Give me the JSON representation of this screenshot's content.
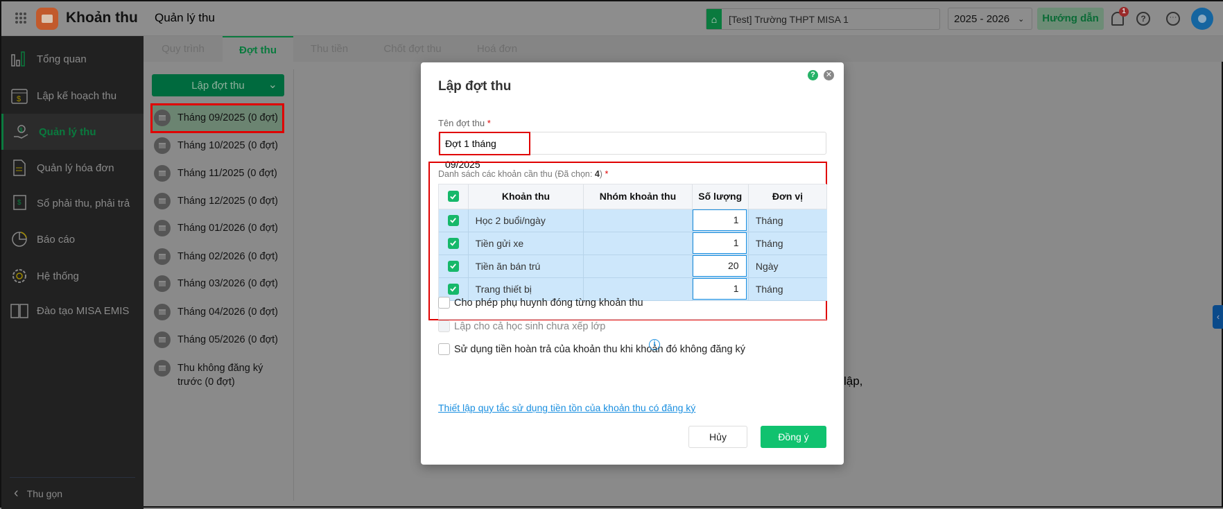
{
  "topbar": {
    "app_name": "Khoản thu",
    "page_title": "Quản lý thu",
    "school": "[Test] Trường THPT MISA 1",
    "school_year": "2025 - 2026",
    "guide_label": "Hướng dẫn",
    "notification_count": "1"
  },
  "sidebar": {
    "items": [
      {
        "label": "Tổng quan",
        "icon": "bar-chart-icon"
      },
      {
        "label": "Lập kế hoạch thu",
        "icon": "calendar-dollar-icon"
      },
      {
        "label": "Quản lý thu",
        "icon": "hand-coin-icon",
        "active": true
      },
      {
        "label": "Quản lý hóa đơn",
        "icon": "document-icon"
      },
      {
        "label": "Sổ phải thu, phải trả",
        "icon": "ledger-icon"
      },
      {
        "label": "Báo cáo",
        "icon": "pie-chart-icon"
      },
      {
        "label": "Hệ thống",
        "icon": "gear-icon"
      },
      {
        "label": "Đào tạo MISA EMIS",
        "icon": "book-icon"
      }
    ],
    "collapse_label": "Thu gọn"
  },
  "tabs": [
    "Quy trình",
    "Đợt thu",
    "Thu tiền",
    "Chốt đợt thu",
    "Hoá đơn"
  ],
  "active_tab": "Đợt thu",
  "left_panel": {
    "create_button": "Lập đợt thu",
    "periods": [
      "Tháng 09/2025 (0 đợt)",
      "Tháng 10/2025 (0 đợt)",
      "Tháng 11/2025 (0 đợt)",
      "Tháng 12/2025 (0 đợt)",
      "Tháng 01/2026 (0 đợt)",
      "Tháng 02/2026 (0 đợt)",
      "Tháng 03/2026 (0 đợt)",
      "Tháng 04/2026 (0 đợt)",
      "Tháng 05/2026 (0 đợt)",
      "Thu không đăng ký trước (0 đợt)"
    ]
  },
  "background_text": "lập,",
  "dialog": {
    "title": "Lập đợt thu",
    "name_label": "Tên đợt thu",
    "required": "*",
    "name_value": "Đợt 1 tháng 09/2025",
    "list_label": "Danh sách các khoản cần thu (Đã chọn: ",
    "selected_count": "4",
    "list_label_end": ")",
    "columns": [
      "Khoản thu",
      "Nhóm khoản thu",
      "Số lượng",
      "Đơn vị"
    ],
    "rows": [
      {
        "name": "Học 2 buổi/ngày",
        "group": "",
        "qty": "1",
        "unit": "Tháng",
        "checked": true
      },
      {
        "name": "Tiền gửi xe",
        "group": "",
        "qty": "1",
        "unit": "Tháng",
        "checked": true
      },
      {
        "name": "Tiền ăn bán trú",
        "group": "",
        "qty": "20",
        "unit": "Ngày",
        "checked": true
      },
      {
        "name": "Trang thiết bị",
        "group": "",
        "qty": "1",
        "unit": "Tháng",
        "checked": true
      }
    ],
    "options": [
      {
        "label": "Cho phép phụ huynh đóng từng khoản thu",
        "checked": false,
        "disabled": false
      },
      {
        "label": "Lập cho cả học sinh chưa xếp lớp",
        "checked": false,
        "disabled": true
      },
      {
        "label": "Sử dụng tiền hoàn trả của khoản thu khi khoản đó không đăng ký",
        "checked": false,
        "disabled": false
      }
    ],
    "link": "Thiết lập quy tắc sử dụng tiền tồn của khoản thu có đăng ký",
    "cancel": "Hủy",
    "confirm": "Đồng ý"
  },
  "colors": {
    "brand_green": "#0a7a3e",
    "confirm_green": "#10c26f",
    "highlight": "#e00000",
    "link": "#1a8fe0",
    "row_selected": "#cde7fb"
  }
}
